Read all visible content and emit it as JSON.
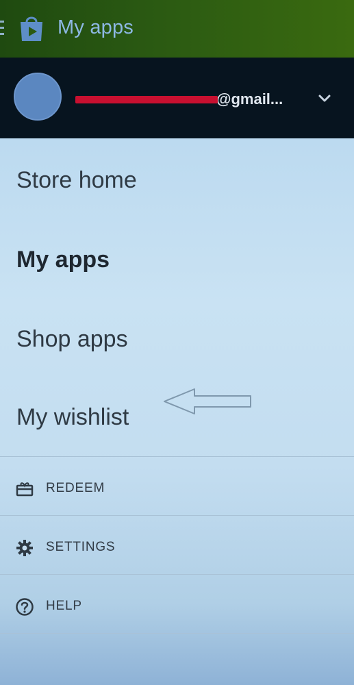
{
  "app_bar": {
    "title": "My apps",
    "icons": [
      "hamburger-icon",
      "play-store-icon"
    ],
    "colors": {
      "background": "#2b5a12",
      "title": "#8db8e4"
    }
  },
  "account": {
    "email": "@gmail...",
    "icons": [
      "avatar",
      "chevron-down-icon"
    ],
    "colors": {
      "background": "#07141f"
    }
  },
  "nav": {
    "items": [
      {
        "label": "Store home",
        "active": false
      },
      {
        "label": "My apps",
        "active": true
      },
      {
        "label": "Shop apps",
        "active": false
      },
      {
        "label": "My wishlist",
        "active": false
      }
    ]
  },
  "actions": {
    "items": [
      {
        "label": "REDEEM",
        "icon": "gift-card-icon"
      },
      {
        "label": "SETTINGS",
        "icon": "gear-icon"
      },
      {
        "label": "HELP",
        "icon": "help-icon"
      }
    ]
  },
  "annotation": {
    "icon": "arrow-left-icon"
  }
}
